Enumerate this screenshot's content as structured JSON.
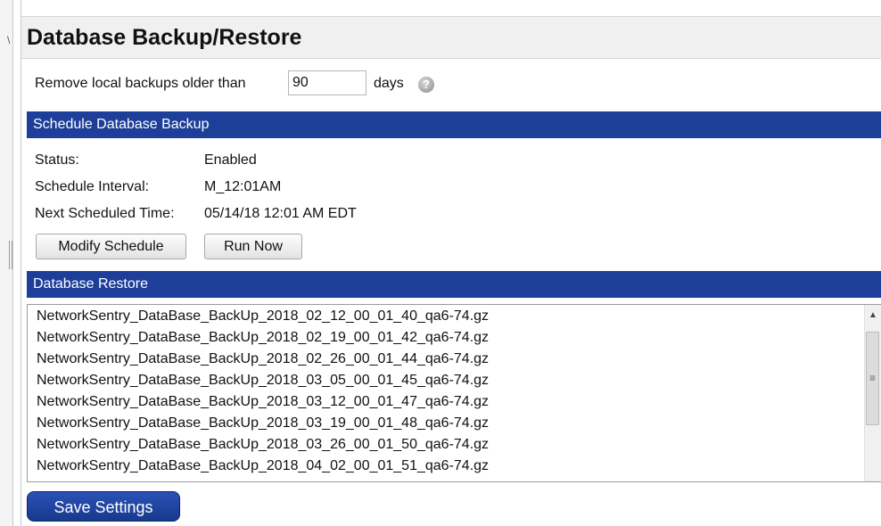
{
  "page": {
    "title": "Database Backup/Restore"
  },
  "retention": {
    "label_before": "Remove local backups older than",
    "days_value": "90",
    "label_after": "days",
    "help_icon": "help-circle-icon"
  },
  "schedule": {
    "header": "Schedule Database Backup",
    "status_label": "Status:",
    "status_value": "Enabled",
    "interval_label": "Schedule Interval:",
    "interval_value": "M_12:01AM",
    "next_label": "Next Scheduled Time:",
    "next_value": "05/14/18 12:01 AM EDT",
    "modify_button": "Modify Schedule",
    "run_button": "Run Now"
  },
  "restore": {
    "header": "Database Restore",
    "files": [
      "NetworkSentry_DataBase_BackUp_2018_02_12_00_01_40_qa6-74.gz",
      "NetworkSentry_DataBase_BackUp_2018_02_19_00_01_42_qa6-74.gz",
      "NetworkSentry_DataBase_BackUp_2018_02_26_00_01_44_qa6-74.gz",
      "NetworkSentry_DataBase_BackUp_2018_03_05_00_01_45_qa6-74.gz",
      "NetworkSentry_DataBase_BackUp_2018_03_12_00_01_47_qa6-74.gz",
      "NetworkSentry_DataBase_BackUp_2018_03_19_00_01_48_qa6-74.gz",
      "NetworkSentry_DataBase_BackUp_2018_03_26_00_01_50_qa6-74.gz",
      "NetworkSentry_DataBase_BackUp_2018_04_02_00_01_51_qa6-74.gz"
    ]
  },
  "footer": {
    "save_button": "Save Settings"
  },
  "colors": {
    "section_header": "#1d3f9a",
    "save_button": "#1f46a6"
  }
}
